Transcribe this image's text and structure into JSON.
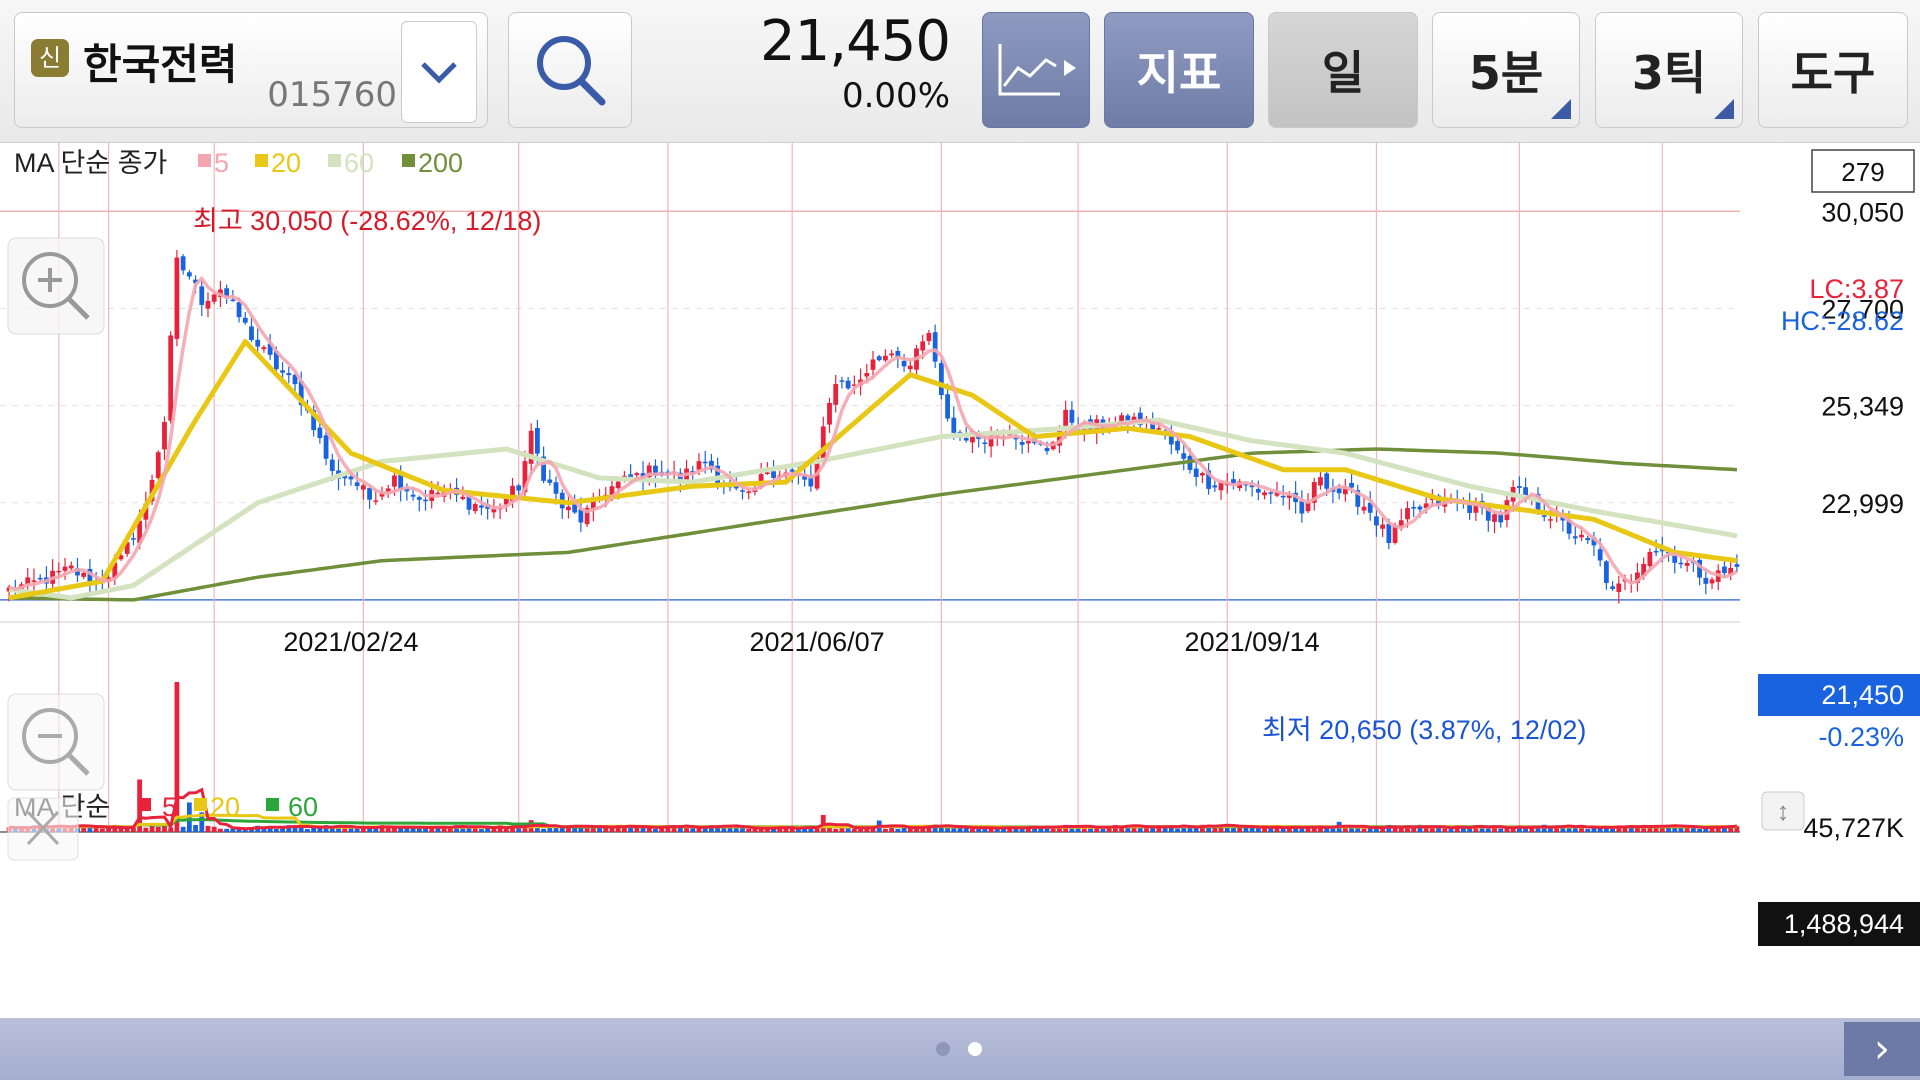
{
  "toolbar": {
    "badge": "신",
    "stock_name": "한국전력",
    "stock_code": "015760",
    "price": "21,450",
    "change": "0.00%",
    "indicator_label": "지표",
    "period_label": "일",
    "minute_label": "5분",
    "tick_label": "3틱",
    "tools_label": "도구"
  },
  "colors": {
    "up": "#e8223a",
    "down": "#1a63e0",
    "ma5": "#f4a6b0",
    "ma20": "#e8c814",
    "ma60": "#d3e2bf",
    "ma200": "#6f8f3a"
  },
  "price_legend": {
    "prefix": "MA 단순 종가",
    "items": [
      {
        "label": "5",
        "color": "#f4a6b0"
      },
      {
        "label": "20",
        "color": "#e8c814"
      },
      {
        "label": "60",
        "color": "#d3e2bf"
      },
      {
        "label": "200",
        "color": "#6f8f3a"
      }
    ]
  },
  "volume_legend": {
    "prefix": "MA 단순",
    "items": [
      {
        "label": "5",
        "color": "#e8223a"
      },
      {
        "label": "20",
        "color": "#e8c814"
      },
      {
        "label": "60",
        "color": "#2aa63a"
      }
    ]
  },
  "right_panel": {
    "count_box": "279",
    "lc": "LC:3.87",
    "hc": "HC:-28.62",
    "current_price": "21,450",
    "current_change": "-0.23%",
    "volume_max": "45,727K",
    "volume_current": "1,488,944"
  },
  "chart_data": {
    "type": "candlestick",
    "price_axis": {
      "ticks": [
        "30,050",
        "27,700",
        "25,349",
        "22,999"
      ],
      "tick_values": [
        30050,
        27700,
        25349,
        22999
      ],
      "ylim": [
        20600,
        31000
      ]
    },
    "x_labels": [
      {
        "label": "2021/02/24",
        "index": 55
      },
      {
        "label": "2021/06/07",
        "index": 130
      },
      {
        "label": "2021/09/14",
        "index": 200
      }
    ],
    "high_annotation": "최고 30,050 (-28.62%, 12/18)",
    "low_annotation": "최저 20,650 (3.87%, 12/02)",
    "n_bars": 279,
    "close_keyframes": [
      [
        0,
        20900
      ],
      [
        5,
        21100
      ],
      [
        10,
        21400
      ],
      [
        14,
        21000
      ],
      [
        18,
        21600
      ],
      [
        22,
        22900
      ],
      [
        25,
        25000
      ],
      [
        27,
        28800
      ],
      [
        29,
        28500
      ],
      [
        31,
        27900
      ],
      [
        34,
        28200
      ],
      [
        37,
        27500
      ],
      [
        40,
        26800
      ],
      [
        43,
        26300
      ],
      [
        46,
        25800
      ],
      [
        49,
        24900
      ],
      [
        52,
        23700
      ],
      [
        55,
        23600
      ],
      [
        58,
        23100
      ],
      [
        62,
        23600
      ],
      [
        66,
        23100
      ],
      [
        70,
        23300
      ],
      [
        74,
        23000
      ],
      [
        78,
        22800
      ],
      [
        82,
        23400
      ],
      [
        84,
        24600
      ],
      [
        86,
        23700
      ],
      [
        89,
        22900
      ],
      [
        92,
        22600
      ],
      [
        96,
        23300
      ],
      [
        100,
        23600
      ],
      [
        104,
        23800
      ],
      [
        108,
        23600
      ],
      [
        112,
        24000
      ],
      [
        116,
        23300
      ],
      [
        119,
        23100
      ],
      [
        122,
        23800
      ],
      [
        126,
        23700
      ],
      [
        129,
        23400
      ],
      [
        131,
        24700
      ],
      [
        133,
        26000
      ],
      [
        136,
        25800
      ],
      [
        139,
        26400
      ],
      [
        142,
        26700
      ],
      [
        145,
        26300
      ],
      [
        148,
        27100
      ],
      [
        150,
        25500
      ],
      [
        152,
        24700
      ],
      [
        155,
        24600
      ],
      [
        158,
        24600
      ],
      [
        161,
        24800
      ],
      [
        164,
        24400
      ],
      [
        167,
        24300
      ],
      [
        170,
        25100
      ],
      [
        173,
        24800
      ],
      [
        177,
        24900
      ],
      [
        181,
        25000
      ],
      [
        185,
        24800
      ],
      [
        189,
        24000
      ],
      [
        193,
        23500
      ],
      [
        197,
        23500
      ],
      [
        201,
        23300
      ],
      [
        205,
        23200
      ],
      [
        208,
        22700
      ],
      [
        211,
        23700
      ],
      [
        213,
        23300
      ],
      [
        216,
        23200
      ],
      [
        219,
        22800
      ],
      [
        222,
        22100
      ],
      [
        225,
        22700
      ],
      [
        229,
        23000
      ],
      [
        233,
        23000
      ],
      [
        237,
        22800
      ],
      [
        240,
        22600
      ],
      [
        242,
        23300
      ],
      [
        245,
        23000
      ],
      [
        249,
        22600
      ],
      [
        252,
        22200
      ],
      [
        255,
        21900
      ],
      [
        258,
        20800
      ],
      [
        261,
        21200
      ],
      [
        264,
        21900
      ],
      [
        267,
        21800
      ],
      [
        270,
        21500
      ],
      [
        273,
        21200
      ],
      [
        276,
        21300
      ],
      [
        278,
        21450
      ]
    ],
    "ma20_keyframes": [
      [
        0,
        20700
      ],
      [
        15,
        21100
      ],
      [
        30,
        25000
      ],
      [
        38,
        26900
      ],
      [
        55,
        24200
      ],
      [
        70,
        23300
      ],
      [
        90,
        23000
      ],
      [
        110,
        23400
      ],
      [
        125,
        23500
      ],
      [
        135,
        24800
      ],
      [
        145,
        26100
      ],
      [
        155,
        25600
      ],
      [
        165,
        24600
      ],
      [
        180,
        24800
      ],
      [
        190,
        24600
      ],
      [
        205,
        23800
      ],
      [
        215,
        23800
      ],
      [
        230,
        23100
      ],
      [
        240,
        22900
      ],
      [
        255,
        22600
      ],
      [
        268,
        21800
      ],
      [
        278,
        21600
      ]
    ],
    "ma60_keyframes": [
      [
        0,
        20900
      ],
      [
        10,
        20700
      ],
      [
        20,
        21000
      ],
      [
        40,
        23000
      ],
      [
        60,
        24000
      ],
      [
        80,
        24300
      ],
      [
        95,
        23600
      ],
      [
        110,
        23500
      ],
      [
        130,
        24000
      ],
      [
        150,
        24600
      ],
      [
        170,
        24800
      ],
      [
        185,
        25000
      ],
      [
        200,
        24500
      ],
      [
        215,
        24200
      ],
      [
        235,
        23400
      ],
      [
        255,
        22800
      ],
      [
        278,
        22200
      ]
    ],
    "ma200_keyframes": [
      [
        0,
        20700
      ],
      [
        20,
        20650
      ],
      [
        40,
        21200
      ],
      [
        60,
        21600
      ],
      [
        90,
        21800
      ],
      [
        120,
        22500
      ],
      [
        150,
        23200
      ],
      [
        180,
        23800
      ],
      [
        200,
        24200
      ],
      [
        220,
        24300
      ],
      [
        240,
        24200
      ],
      [
        260,
        23950
      ],
      [
        278,
        23800
      ]
    ],
    "volume_axis": {
      "max": 45727000,
      "label": "45,727K"
    },
    "volume_spikes": [
      {
        "index": 21,
        "value": 16000000
      },
      {
        "index": 27,
        "value": 45727000
      },
      {
        "index": 29,
        "value": 9000000
      },
      {
        "index": 31,
        "value": 6000000
      },
      {
        "index": 84,
        "value": 3600000
      },
      {
        "index": 131,
        "value": 5200000
      },
      {
        "index": 140,
        "value": 3500000
      },
      {
        "index": 149,
        "value": 2300000
      },
      {
        "index": 214,
        "value": 3100000
      }
    ]
  }
}
